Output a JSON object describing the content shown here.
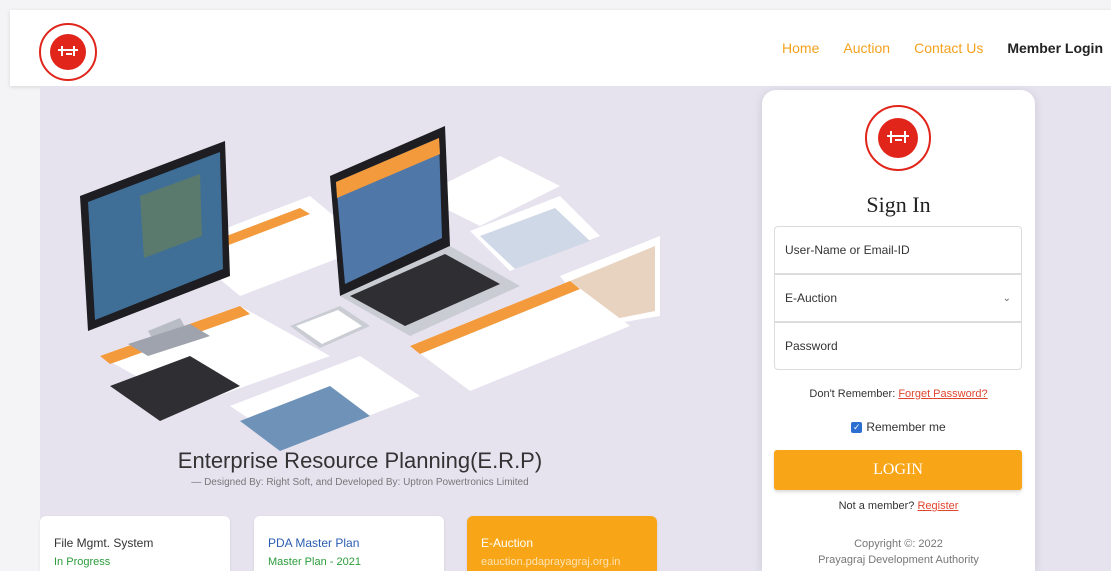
{
  "header": {
    "nav": [
      "Home",
      "Auction",
      "Contact Us",
      "Member Login"
    ]
  },
  "hero": {
    "title": "Enterprise Resource Planning(E.R.P)",
    "subtitle": "— Designed By: Right Soft, and Developed By: Uptron Powertronics Limited"
  },
  "cards": [
    {
      "title": "File Mgmt. System",
      "status": "In Progress"
    },
    {
      "title": "PDA Master Plan",
      "status": "Master Plan - 2021"
    },
    {
      "title": "E-Auction",
      "status": "eauction.pdaprayagraj.org.in"
    }
  ],
  "login": {
    "heading": "Sign In",
    "username_placeholder": "User-Name or Email-ID",
    "module_selected": "E-Auction",
    "password_placeholder": "Password",
    "forget_prefix": "Don't Remember:",
    "forget_link": "Forget Password?",
    "remember_label": "Remember me",
    "login_label": "LOGIN",
    "not_member": "Not a member?",
    "register_link": "Register",
    "copyright": "Copyright ©: 2022",
    "org": "Prayagraj Development Authority"
  },
  "colors": {
    "accent": "#f8a617",
    "logo_red": "#e1251b",
    "link_red": "#e0452f"
  }
}
